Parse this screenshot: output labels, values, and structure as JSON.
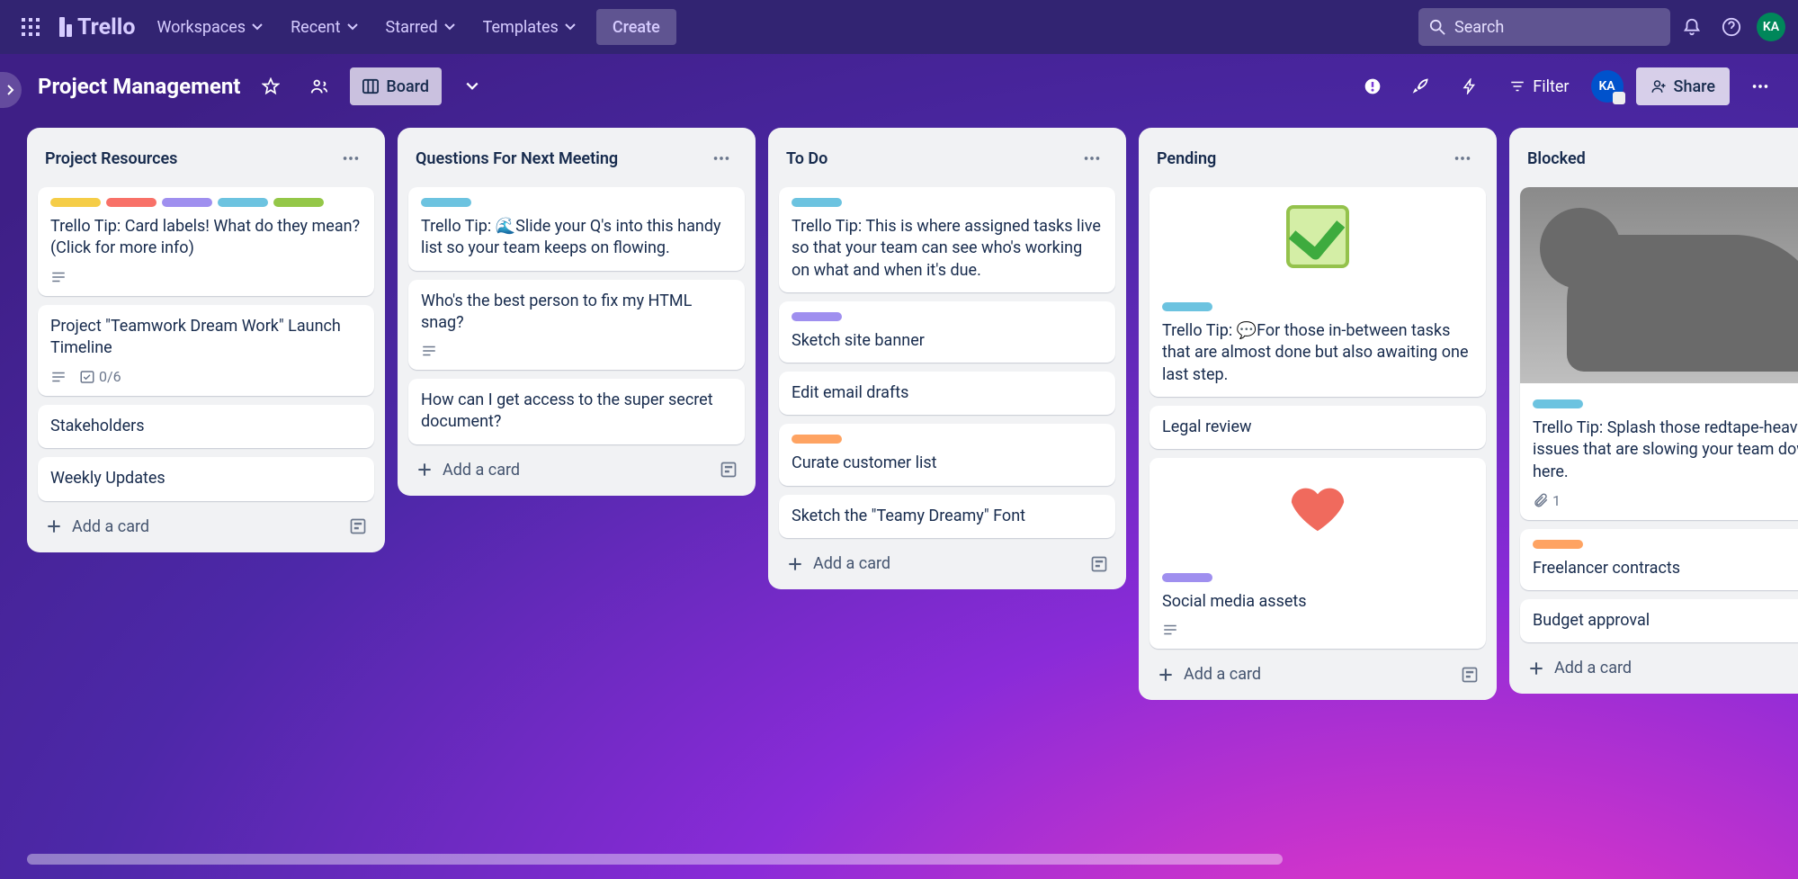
{
  "nav": {
    "logo": "Trello",
    "workspaces": "Workspaces",
    "recent": "Recent",
    "starred": "Starred",
    "templates": "Templates",
    "create": "Create",
    "search_placeholder": "Search",
    "avatar": "KA"
  },
  "board_bar": {
    "title": "Project Management",
    "view": "Board",
    "filter": "Filter",
    "share": "Share",
    "member": "KA"
  },
  "labels": {
    "yellow": "#f5cd47",
    "red": "#f87168",
    "purple": "#9f8fef",
    "sky": "#6cc3e0",
    "green": "#94c748",
    "orange": "#fea362"
  },
  "lists": [
    {
      "title": "Project Resources",
      "cards": [
        {
          "labels": [
            "yellow",
            "red",
            "purple",
            "sky",
            "green"
          ],
          "text": "Trello Tip: Card labels! What do they mean? (Click for more info)",
          "badges": {
            "desc": true
          }
        },
        {
          "text": "Project \"Teamwork Dream Work\" Launch Timeline",
          "badges": {
            "desc": true,
            "check": "0/6"
          }
        },
        {
          "text": "Stakeholders"
        },
        {
          "text": "Weekly Updates"
        }
      ],
      "add": "Add a card"
    },
    {
      "title": "Questions For Next Meeting",
      "cards": [
        {
          "labels": [
            "sky"
          ],
          "text": "Trello Tip: 🌊Slide your Q's into this handy list so your team keeps on flowing."
        },
        {
          "text": "Who's the best person to fix my HTML snag?",
          "badges": {
            "desc": true
          }
        },
        {
          "text": "How can I get access to the super secret document?"
        }
      ],
      "add": "Add a card"
    },
    {
      "title": "To Do",
      "cards": [
        {
          "labels": [
            "sky"
          ],
          "text": "Trello Tip: This is where assigned tasks live so that your team can see who's working on what and when it's due."
        },
        {
          "labels": [
            "purple"
          ],
          "text": "Sketch site banner"
        },
        {
          "text": "Edit email drafts"
        },
        {
          "labels": [
            "orange"
          ],
          "text": "Curate customer list"
        },
        {
          "text": "Sketch the \"Teamy Dreamy\" Font"
        }
      ],
      "add": "Add a card"
    },
    {
      "title": "Pending",
      "cards": [
        {
          "cover": "check",
          "labels": [
            "sky"
          ],
          "text": "Trello Tip: 💬For those in-between tasks that are almost done but also awaiting one last step."
        },
        {
          "text": "Legal review"
        },
        {
          "cover": "heart",
          "labels": [
            "purple"
          ],
          "text": "Social media assets",
          "badges": {
            "desc": true
          }
        }
      ],
      "add": "Add a card"
    },
    {
      "title": "Blocked",
      "cards": [
        {
          "cover": "cat",
          "labels": [
            "sky"
          ],
          "text": "Trello Tip: Splash those redtape-heavy issues that are slowing your team down here.",
          "badges": {
            "attach": "1"
          }
        },
        {
          "labels": [
            "orange"
          ],
          "text": "Freelancer contracts"
        },
        {
          "text": "Budget approval"
        }
      ],
      "add": "Add a card"
    }
  ]
}
